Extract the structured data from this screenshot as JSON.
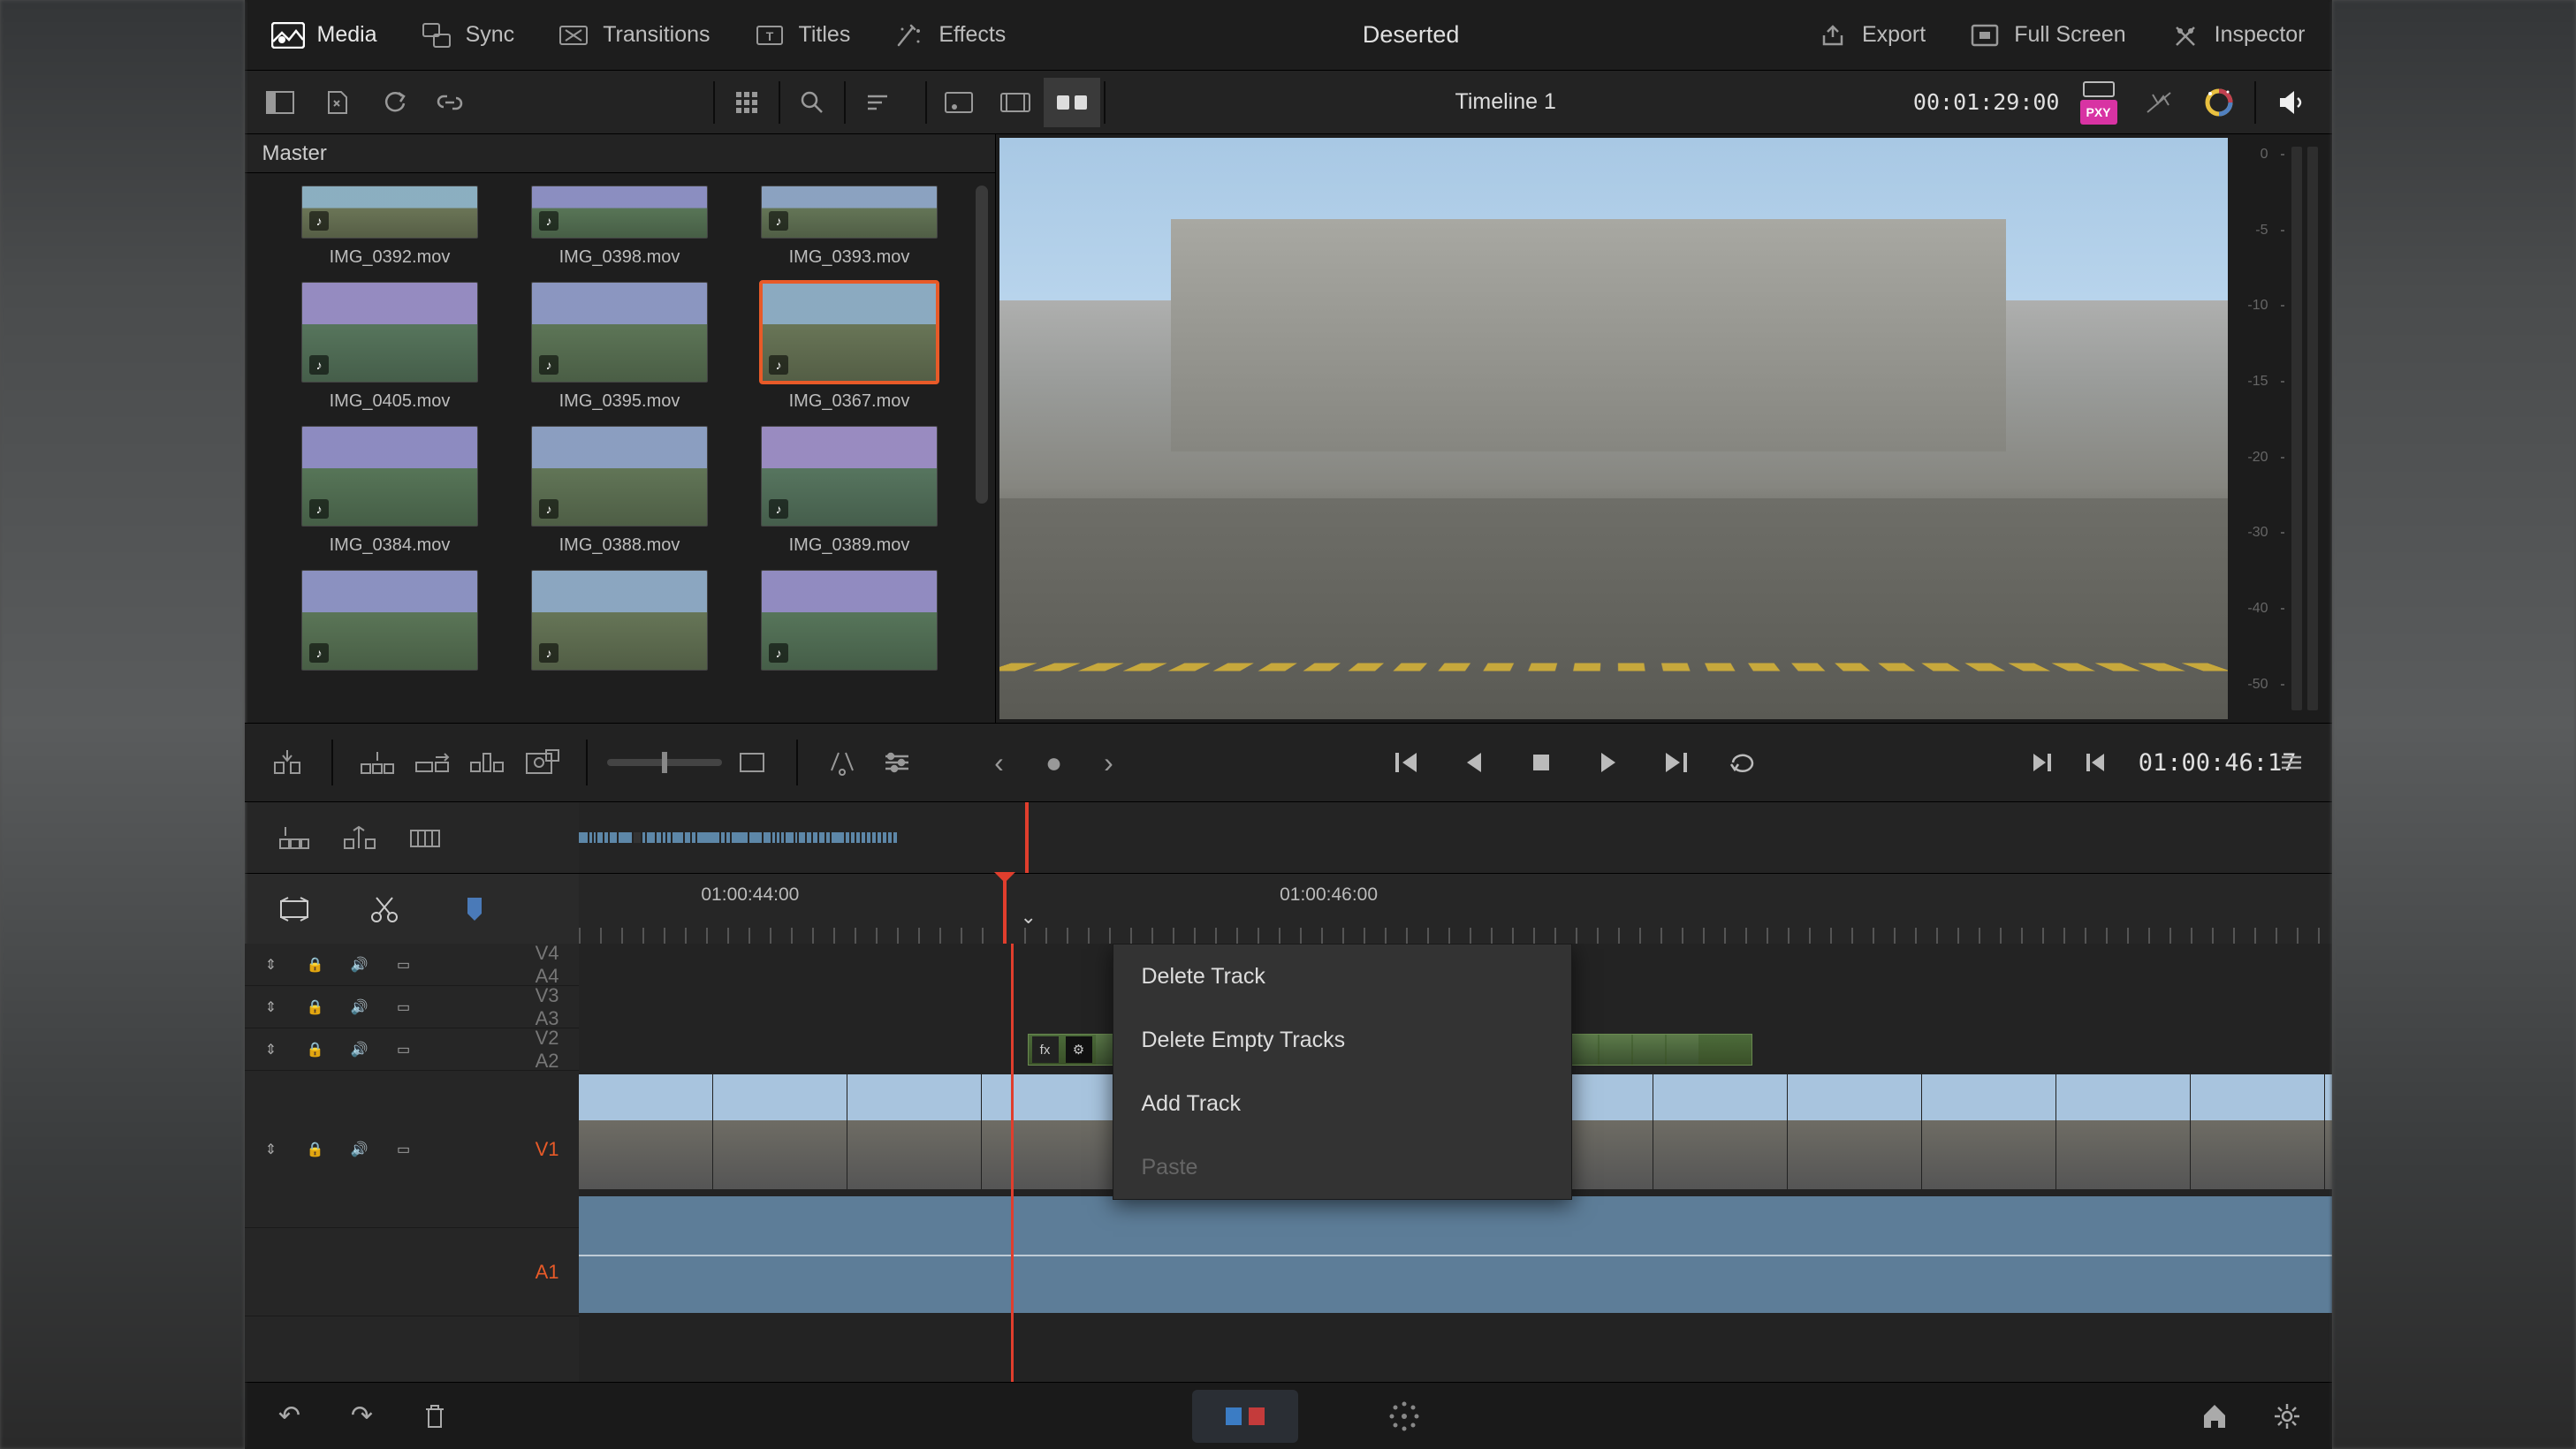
{
  "project_title": "Deserted",
  "menu": {
    "media": "Media",
    "sync": "Sync",
    "transitions": "Transitions",
    "titles": "Titles",
    "effects": "Effects",
    "export": "Export",
    "full_screen": "Full Screen",
    "inspector": "Inspector"
  },
  "timeline_header": {
    "name": "Timeline 1",
    "duration_tc": "00:01:29:00",
    "proxy_badge": "PXY"
  },
  "media_pool": {
    "path": "Master",
    "clips": [
      {
        "name": "IMG_0392.mov"
      },
      {
        "name": "IMG_0398.mov"
      },
      {
        "name": "IMG_0393.mov"
      },
      {
        "name": "IMG_0405.mov"
      },
      {
        "name": "IMG_0395.mov"
      },
      {
        "name": "IMG_0367.mov",
        "selected": true
      },
      {
        "name": "IMG_0384.mov"
      },
      {
        "name": "IMG_0388.mov"
      },
      {
        "name": "IMG_0389.mov"
      },
      {
        "name": ""
      },
      {
        "name": ""
      },
      {
        "name": ""
      }
    ]
  },
  "meters": {
    "scale": [
      "0",
      "-5",
      "-10",
      "-15",
      "-20",
      "-30",
      "-40",
      "-50"
    ]
  },
  "ruler": {
    "labels": [
      {
        "tc": "01:00:44:00",
        "left_pct": 7
      },
      {
        "tc": "01:00:46:00",
        "left_pct": 40
      }
    ]
  },
  "transport": {
    "current_tc": "01:00:46:17"
  },
  "track_labels": {
    "v4": "V4",
    "a4": "A4",
    "v3": "V3",
    "a3": "A3",
    "v2": "V2",
    "a2": "A2",
    "v1": "V1",
    "a1": "A1"
  },
  "context_menu": {
    "items": [
      {
        "label": "Delete Track",
        "enabled": true
      },
      {
        "label": "Delete Empty Tracks",
        "enabled": true
      },
      {
        "label": "Add Track",
        "enabled": true
      },
      {
        "label": "Paste",
        "enabled": false
      }
    ]
  },
  "v2_clip": {
    "fx_label": "fx"
  }
}
